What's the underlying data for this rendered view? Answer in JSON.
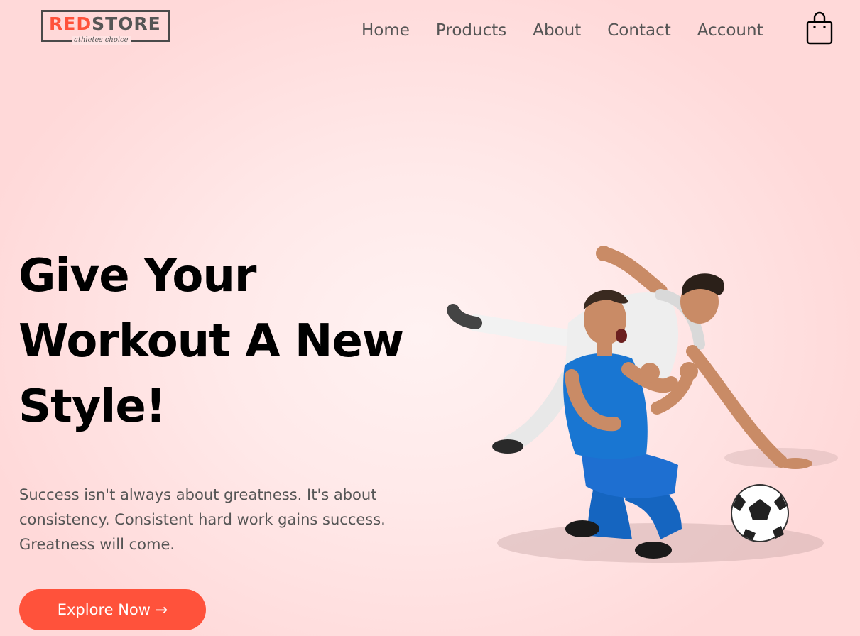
{
  "brand": {
    "name_red": "RED",
    "name_dark": "STORE",
    "tagline": "athletes choice",
    "accent_color": "#ff523b"
  },
  "nav": {
    "items": [
      "Home",
      "Products",
      "About",
      "Contact",
      "Account"
    ],
    "cart_icon": "shopping-bag-icon"
  },
  "hero": {
    "headline_lines": [
      "Give Your",
      "Workout A New",
      "Style!"
    ],
    "subtext_lines": [
      "Success isn't always about greatness. It's about",
      "consistency. Consistent hard work gains success.",
      "Greatness will come."
    ],
    "cta_label": "Explore Now",
    "cta_arrow": "→",
    "image": "football-players-celebrating"
  }
}
